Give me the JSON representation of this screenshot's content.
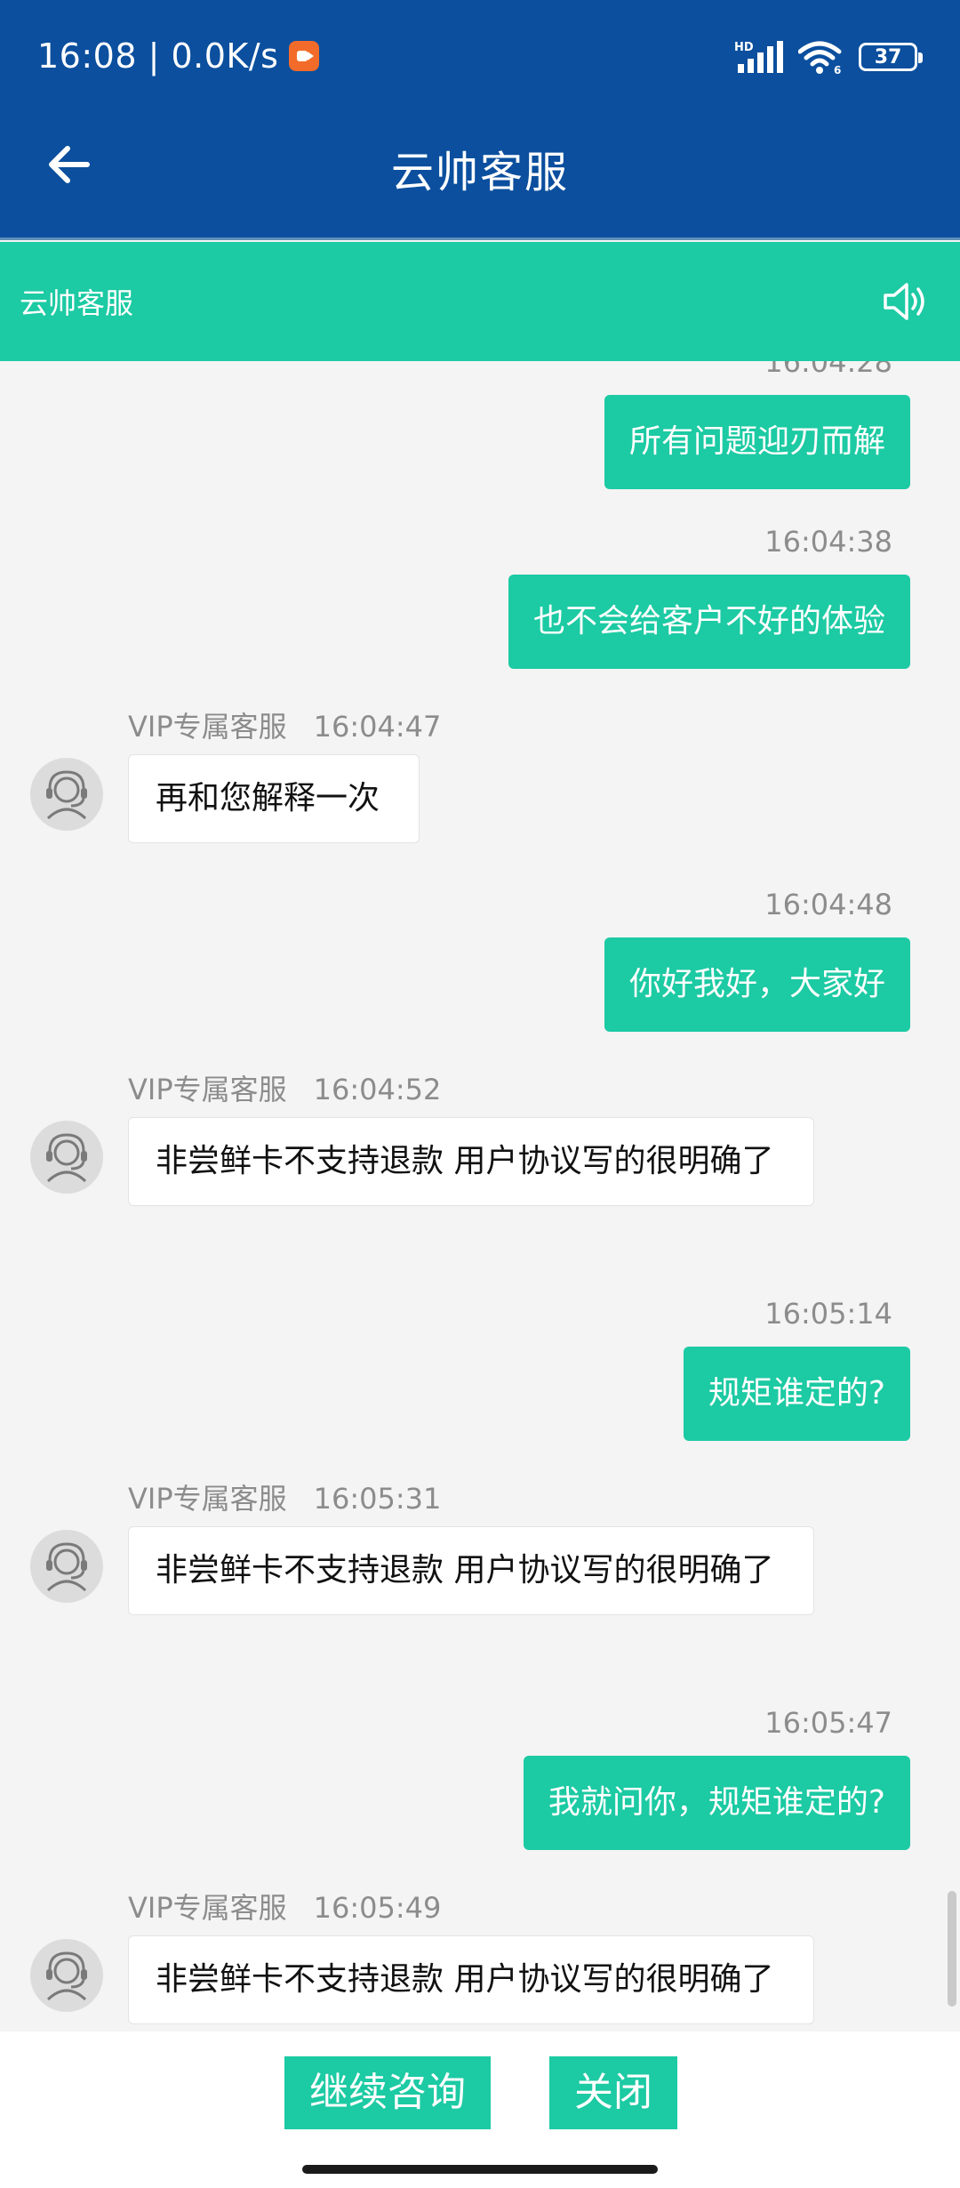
{
  "status_bar": {
    "time_speed": "16:08 | 0.0K/s",
    "network": "HD",
    "wifi_badge": "6",
    "battery": "37"
  },
  "header": {
    "title": "云帅客服"
  },
  "sub_header": {
    "title": "云帅客服"
  },
  "chat": {
    "agent_name": "VIP专属客服",
    "partial_top_time": "16:04:28",
    "messages": [
      {
        "side": "out",
        "text": "所有问题迎刃而解"
      },
      {
        "side": "out",
        "time": "16:04:38",
        "text": "也不会给客户不好的体验"
      },
      {
        "side": "in",
        "time": "16:04:47",
        "text": "再和您解释一次"
      },
      {
        "side": "out",
        "time": "16:04:48",
        "text": "你好我好，大家好"
      },
      {
        "side": "in",
        "time": "16:04:52",
        "text": "非尝鲜卡不支持退款 用户协议写的很明确了"
      },
      {
        "side": "out",
        "time": "16:05:14",
        "text": "规矩谁定的?"
      },
      {
        "side": "in",
        "time": "16:05:31",
        "text": "非尝鲜卡不支持退款 用户协议写的很明确了"
      },
      {
        "side": "out",
        "time": "16:05:47",
        "text": "我就问你，规矩谁定的?"
      },
      {
        "side": "in",
        "time": "16:05:49",
        "text": "非尝鲜卡不支持退款 用户协议写的很明确了"
      }
    ]
  },
  "bottom": {
    "continue_label": "继续咨询",
    "close_label": "关闭"
  },
  "colors": {
    "header_blue": "#0b4f9e",
    "accent_teal": "#1ccaa3",
    "background": "#f4f4f4"
  }
}
